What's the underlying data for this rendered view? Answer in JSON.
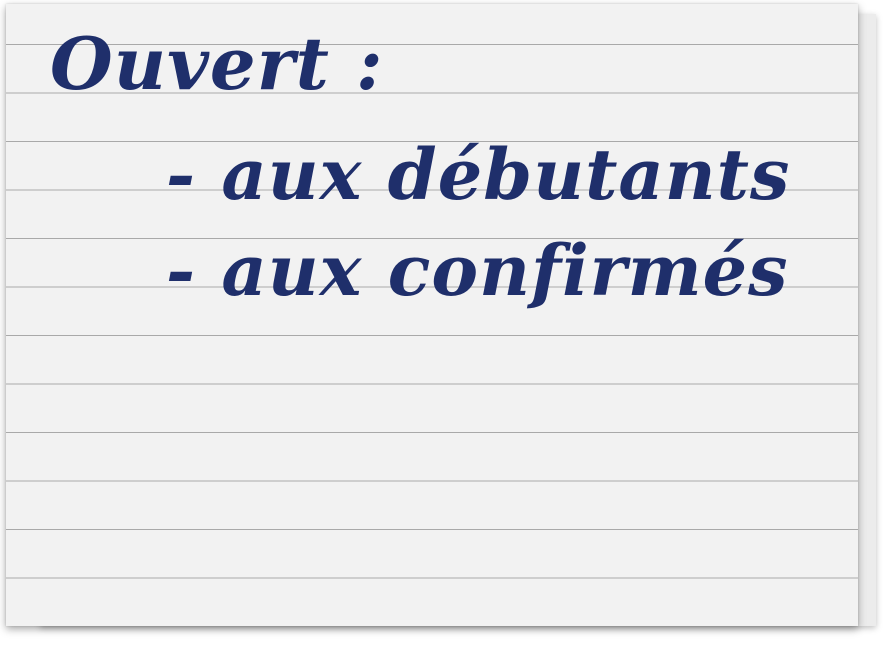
{
  "note": {
    "title": "Ouvert :",
    "items": [
      {
        "label": "- aux débutants"
      },
      {
        "label": "- aux confirmés"
      }
    ]
  },
  "colors": {
    "ink": "#1f2f6b",
    "paper": "#f2f2f2",
    "rule_line": "#a9a9a9"
  }
}
